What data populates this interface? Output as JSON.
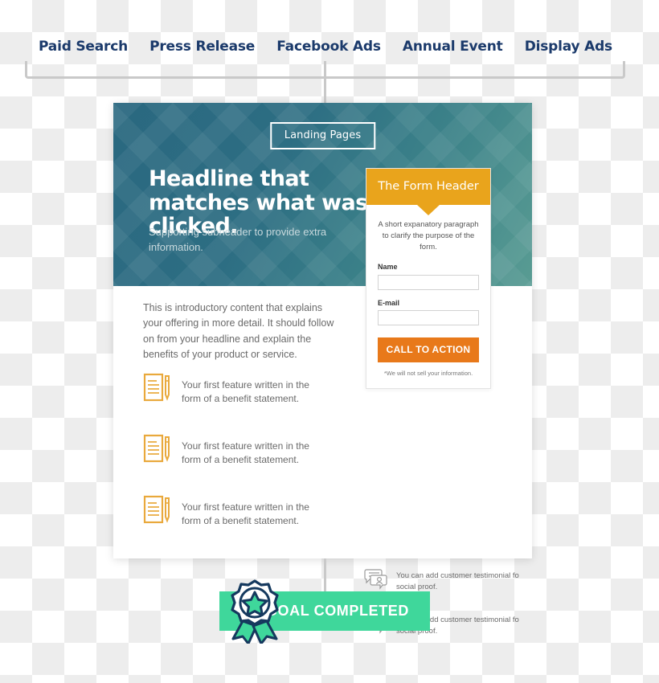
{
  "channels": [
    {
      "label": "Paid Search"
    },
    {
      "label": "Press Release"
    },
    {
      "label": "Facebook Ads"
    },
    {
      "label": "Annual Event"
    },
    {
      "label": "Display Ads"
    }
  ],
  "landing_page": {
    "badge": "Landing Pages",
    "headline": "Headline that matches what was clicked.",
    "subheader": "Supporting subheader to provide extra information.",
    "intro": "This is introductory content that explains your offering in more detail. It should follow on from your headline and explain the benefits of your product or service.",
    "features": [
      {
        "icon": "document-pen-icon",
        "text": "Your first feature written in the form of a benefit statement."
      },
      {
        "icon": "document-pen-icon",
        "text": "Your first feature written in the form of a benefit statement."
      },
      {
        "icon": "document-pen-icon",
        "text": "Your first feature written in the form of a benefit statement."
      }
    ],
    "testimonials": [
      {
        "icon": "testimonial-bubble-icon",
        "text": "You can add customer testimonial fo social proof."
      },
      {
        "icon": "testimonial-bubble-icon",
        "text": "You can add customer testimonial fo social proof."
      }
    ]
  },
  "form": {
    "header": "The Form Header",
    "intro": "A short expanatory paragraph to clarify the purpose of the form.",
    "fields": [
      {
        "label": "Name",
        "value": "",
        "placeholder": ""
      },
      {
        "label": "E-mail",
        "value": "",
        "placeholder": ""
      }
    ],
    "cta_label": "CALL TO ACTION",
    "disclaimer": "*We will not sell your information."
  },
  "goal": {
    "label": "GOAL COMPLETED",
    "icon": "award-ribbon-icon"
  },
  "colors": {
    "channel_label": "#1b3a6b",
    "hero_gradient_start": "#2a6880",
    "hero_gradient_end": "#599c93",
    "form_header_orange": "#e9a41c",
    "cta_orange": "#e8791a",
    "goal_green": "#3fd79b",
    "medal_navy": "#15395e",
    "connector_gray": "#c9c9c9",
    "feature_icon_orange": "#e9a93c"
  }
}
